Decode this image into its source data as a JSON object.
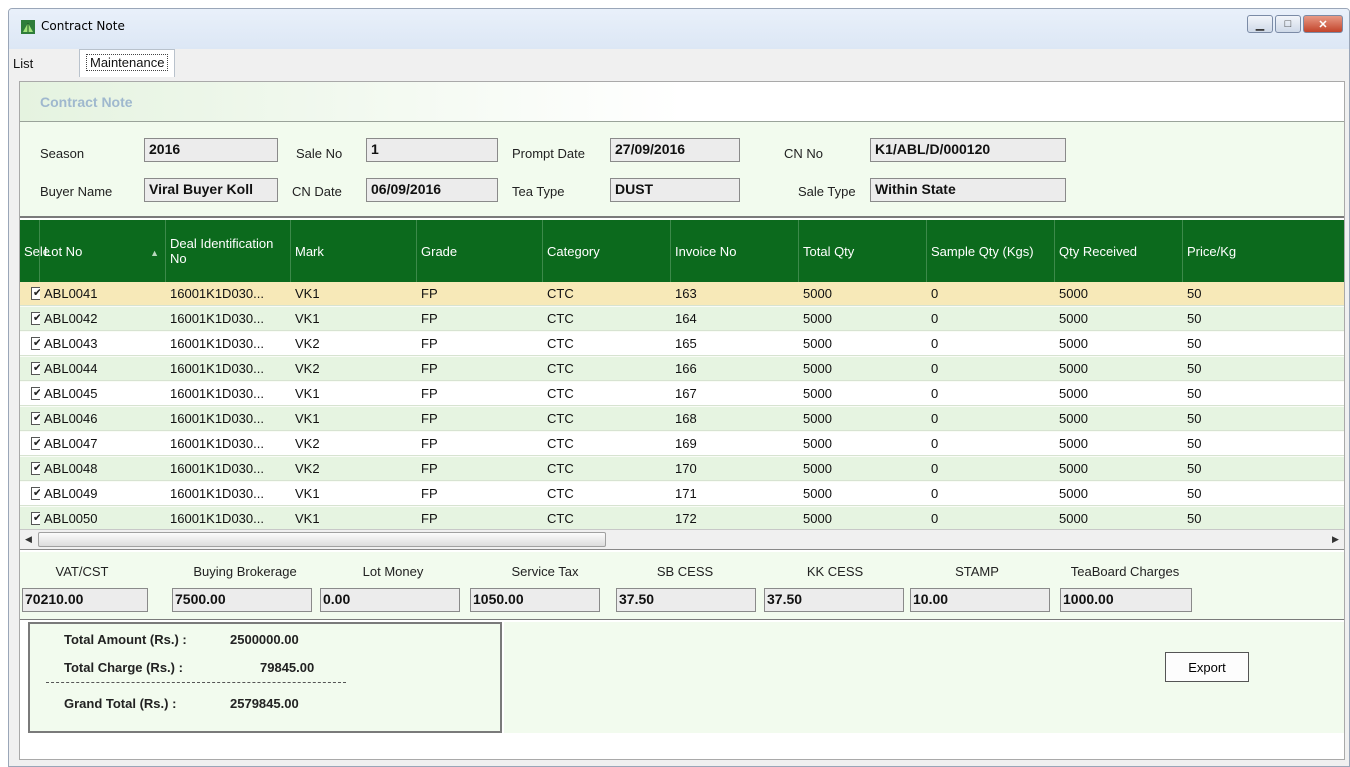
{
  "window": {
    "title": "Contract Note",
    "minimize_glyph": "▁",
    "maximize_glyph": "□",
    "close_glyph": "✕"
  },
  "tabs": {
    "list_label": "List",
    "maintenance_label": "Maintenance"
  },
  "section": {
    "title": "Contract Note"
  },
  "fields": {
    "season": {
      "label": "Season",
      "value": "2016"
    },
    "sale_no": {
      "label": "Sale No",
      "value": "1"
    },
    "prompt_date": {
      "label": "Prompt Date",
      "value": "27/09/2016"
    },
    "cn_no": {
      "label": "CN No",
      "value": "K1/ABL/D/000120"
    },
    "buyer_name": {
      "label": "Buyer Name",
      "value": "Viral Buyer Koll"
    },
    "cn_date": {
      "label": "CN Date",
      "value": "06/09/2016"
    },
    "tea_type": {
      "label": "Tea Type",
      "value": "DUST"
    },
    "sale_type": {
      "label": "Sale Type",
      "value": "Within State"
    }
  },
  "grid": {
    "columns": [
      "Sele",
      "Lot No",
      "Deal Identification No",
      "Mark",
      "Grade",
      "Category",
      "Invoice No",
      "Total Qty",
      "Sample Qty (Kgs)",
      "Qty Received",
      "Price/Kg"
    ],
    "check_glyph": "✔",
    "sort_glyph": "▲",
    "rows": [
      {
        "lot": "ABL0041",
        "deal": "16001K1D030...",
        "mark": "VK1",
        "grade": "FP",
        "category": "CTC",
        "invoice": "163",
        "total": "5000",
        "sample": "0",
        "received": "5000",
        "price": "50"
      },
      {
        "lot": "ABL0042",
        "deal": "16001K1D030...",
        "mark": "VK1",
        "grade": "FP",
        "category": "CTC",
        "invoice": "164",
        "total": "5000",
        "sample": "0",
        "received": "5000",
        "price": "50"
      },
      {
        "lot": "ABL0043",
        "deal": "16001K1D030...",
        "mark": "VK2",
        "grade": "FP",
        "category": "CTC",
        "invoice": "165",
        "total": "5000",
        "sample": "0",
        "received": "5000",
        "price": "50"
      },
      {
        "lot": "ABL0044",
        "deal": "16001K1D030...",
        "mark": "VK2",
        "grade": "FP",
        "category": "CTC",
        "invoice": "166",
        "total": "5000",
        "sample": "0",
        "received": "5000",
        "price": "50"
      },
      {
        "lot": "ABL0045",
        "deal": "16001K1D030...",
        "mark": "VK1",
        "grade": "FP",
        "category": "CTC",
        "invoice": "167",
        "total": "5000",
        "sample": "0",
        "received": "5000",
        "price": "50"
      },
      {
        "lot": "ABL0046",
        "deal": "16001K1D030...",
        "mark": "VK1",
        "grade": "FP",
        "category": "CTC",
        "invoice": "168",
        "total": "5000",
        "sample": "0",
        "received": "5000",
        "price": "50"
      },
      {
        "lot": "ABL0047",
        "deal": "16001K1D030...",
        "mark": "VK2",
        "grade": "FP",
        "category": "CTC",
        "invoice": "169",
        "total": "5000",
        "sample": "0",
        "received": "5000",
        "price": "50"
      },
      {
        "lot": "ABL0048",
        "deal": "16001K1D030...",
        "mark": "VK2",
        "grade": "FP",
        "category": "CTC",
        "invoice": "170",
        "total": "5000",
        "sample": "0",
        "received": "5000",
        "price": "50"
      },
      {
        "lot": "ABL0049",
        "deal": "16001K1D030...",
        "mark": "VK1",
        "grade": "FP",
        "category": "CTC",
        "invoice": "171",
        "total": "5000",
        "sample": "0",
        "received": "5000",
        "price": "50"
      },
      {
        "lot": "ABL0050",
        "deal": "16001K1D030...",
        "mark": "VK1",
        "grade": "FP",
        "category": "CTC",
        "invoice": "172",
        "total": "5000",
        "sample": "0",
        "received": "5000",
        "price": "50"
      }
    ],
    "scroll_left_glyph": "◀",
    "scroll_right_glyph": "▶"
  },
  "charges": [
    {
      "label": "VAT/CST",
      "value": "70210.00"
    },
    {
      "label": "Buying Brokerage",
      "value": "7500.00"
    },
    {
      "label": "Lot Money",
      "value": "0.00"
    },
    {
      "label": "Service Tax",
      "value": "1050.00"
    },
    {
      "label": "SB CESS",
      "value": "37.50"
    },
    {
      "label": "KK CESS",
      "value": "37.50"
    },
    {
      "label": "STAMP",
      "value": "10.00"
    },
    {
      "label": "TeaBoard Charges",
      "value": "1000.00"
    }
  ],
  "totals": {
    "total_amount_label": "Total Amount (Rs.) :",
    "total_amount": "2500000.00",
    "total_charge_label": "Total Charge (Rs.) :",
    "total_charge": "79845.00",
    "grand_total_label": "Grand Total (Rs.) :",
    "grand_total": "2579845.00"
  },
  "export_label": "Export",
  "colors": {
    "grid_header": "#0c6a1d",
    "selected_row": "#f7e9b8",
    "alt_row": "#e6f4e1",
    "panel_bg": "#f2fbee",
    "section_title": "#9fb8ce"
  }
}
